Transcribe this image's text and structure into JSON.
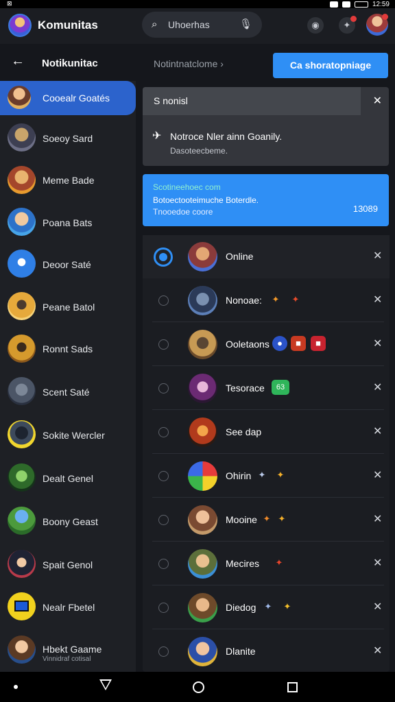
{
  "status_bar": {
    "left": "⊠",
    "time": "12:59"
  },
  "app_bar": {
    "title": "Komunitas",
    "search": {
      "text": "Uhoerhas",
      "icon": "search-icon",
      "mic_icon": "mic-icon"
    },
    "icons": [
      "location-icon",
      "bell-icon",
      "profile-avatar"
    ],
    "accent": "#2f8ff5"
  },
  "sub_bar": {
    "back_icon": "arrow-left-icon",
    "title": "Notikunitac",
    "crumb": "Notintnatclome ›",
    "cta_label": "Ca shoratopniage"
  },
  "sidebar": {
    "items": [
      {
        "label": "Cooealr Goatés",
        "active": true
      },
      {
        "label": "Soeoy Sard"
      },
      {
        "label": "Meme Bade"
      },
      {
        "label": "Poana Bats"
      },
      {
        "label": "Deoor Saté"
      },
      {
        "label": "Peane Batol"
      },
      {
        "label": "Ronnt Sads"
      },
      {
        "label": "Scent Saté"
      },
      {
        "label": "Sokite Wercler"
      },
      {
        "label": "Dealt Genel"
      },
      {
        "label": "Boony Geast"
      },
      {
        "label": "Spait Genol"
      },
      {
        "label": "Nealr Fbetel"
      },
      {
        "label": "Hbekt Gaame",
        "sub": "Vinnidraf cotisal"
      }
    ]
  },
  "alert": {
    "title": "S nonisl",
    "message": "Notroce Nler ainn Goanily.",
    "sub": "Dasoteecbeme.",
    "close_icon": "close-icon",
    "icon": "megaphone-icon"
  },
  "info_banner": {
    "line1": "Scotineehoec com",
    "line2": "Botoectooteimuche Boterdle.",
    "line3": "Tnooedoe coore",
    "count": "13089"
  },
  "notifications": [
    {
      "name": "Online",
      "selected": true,
      "badges": []
    },
    {
      "name": "Nonoae:",
      "badges": [
        "✦",
        "✦"
      ]
    },
    {
      "name": "Ooletaons",
      "badges": [
        "●",
        "■",
        "■"
      ]
    },
    {
      "name": "Tesorace",
      "badges": [
        "63"
      ]
    },
    {
      "name": "See dap",
      "badges": []
    },
    {
      "name": "Ohirin",
      "badges": [
        "✦",
        "✦"
      ]
    },
    {
      "name": "Mooine",
      "badges": [
        "✦",
        "✦"
      ]
    },
    {
      "name": "Mecires",
      "badges": [
        "✦"
      ]
    },
    {
      "name": "Diedog",
      "badges": [
        "✦",
        "✦"
      ]
    },
    {
      "name": "Dlanite",
      "badges": []
    }
  ],
  "nav_bar": {
    "icons": [
      "dot-icon",
      "back-triangle-icon",
      "home-circle-icon",
      "recents-square-icon"
    ]
  }
}
